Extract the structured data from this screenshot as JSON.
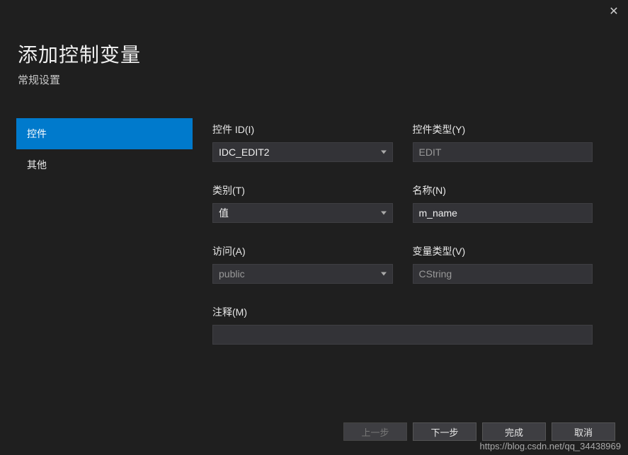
{
  "close": "✕",
  "header": {
    "title": "添加控制变量",
    "subtitle": "常规设置"
  },
  "sidebar": {
    "items": [
      {
        "label": "控件",
        "active": true
      },
      {
        "label": "其他",
        "active": false
      }
    ]
  },
  "form": {
    "control_id": {
      "label": "控件 ID(I)",
      "value": "IDC_EDIT2"
    },
    "control_type": {
      "label": "控件类型(Y)",
      "value": "EDIT"
    },
    "category": {
      "label": "类别(T)",
      "value": "值"
    },
    "name": {
      "label": "名称(N)",
      "value": "m_name"
    },
    "access": {
      "label": "访问(A)",
      "value": "public"
    },
    "var_type": {
      "label": "变量类型(V)",
      "value": "CString"
    },
    "comment": {
      "label": "注释(M)",
      "value": ""
    }
  },
  "footer": {
    "prev": "上一步",
    "next": "下一步",
    "finish": "完成",
    "cancel": "取消"
  },
  "watermark": "https://blog.csdn.net/qq_34438969"
}
